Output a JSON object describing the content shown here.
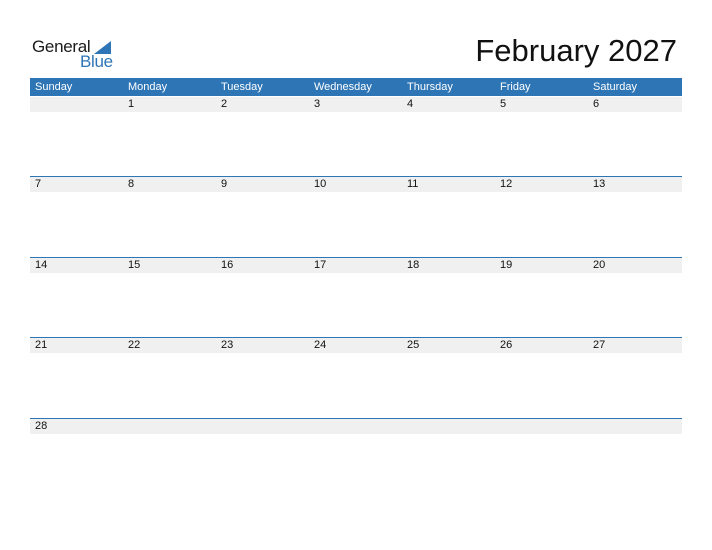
{
  "logo": {
    "general": "General",
    "blue": "Blue",
    "icon": "triangle-flag-icon"
  },
  "title": "February 2027",
  "colors": {
    "accent": "#2e75b6",
    "day_row_bg": "#f0f0f0"
  },
  "weekdays": [
    "Sunday",
    "Monday",
    "Tuesday",
    "Wednesday",
    "Thursday",
    "Friday",
    "Saturday"
  ],
  "weeks": [
    [
      "",
      "1",
      "2",
      "3",
      "4",
      "5",
      "6"
    ],
    [
      "7",
      "8",
      "9",
      "10",
      "11",
      "12",
      "13"
    ],
    [
      "14",
      "15",
      "16",
      "17",
      "18",
      "19",
      "20"
    ],
    [
      "21",
      "22",
      "23",
      "24",
      "25",
      "26",
      "27"
    ],
    [
      "28",
      "",
      "",
      "",
      "",
      "",
      ""
    ]
  ]
}
